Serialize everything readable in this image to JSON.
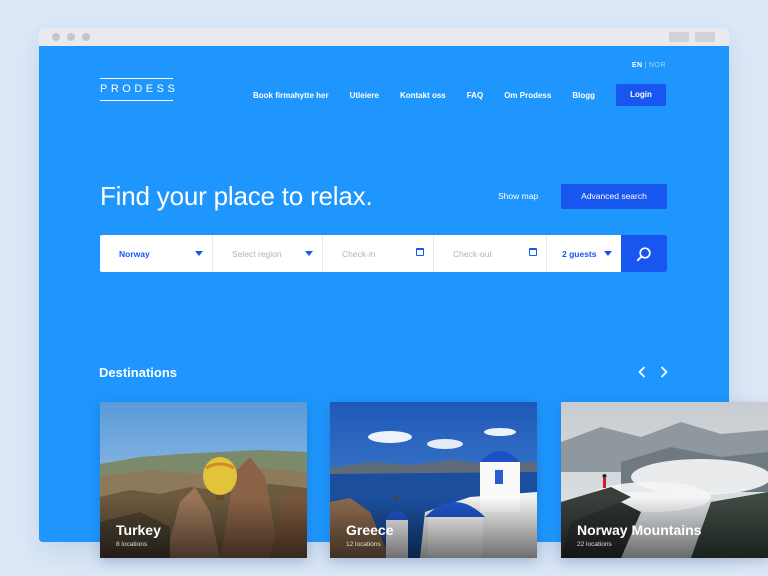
{
  "brand": {
    "logo": "PRODESS"
  },
  "lang": {
    "active": "EN",
    "inactive": "NOR"
  },
  "nav": {
    "links": [
      "Book firmahytte her",
      "Utleiere",
      "Kontakt oss",
      "FAQ",
      "Om Prodess",
      "Blogg"
    ],
    "login": "Login"
  },
  "hero": {
    "title": "Find your place to relax.",
    "show_map": "Show map",
    "advanced_search": "Advanced search"
  },
  "search": {
    "country": "Norway",
    "region_placeholder": "Select region",
    "checkin_placeholder": "Check-in",
    "checkout_placeholder": "Check-out",
    "guests": "2 guests"
  },
  "destinations": {
    "title": "Destinations",
    "cards": [
      {
        "name": "Turkey",
        "count": "8 locations"
      },
      {
        "name": "Greece",
        "count": "12 locations"
      },
      {
        "name": "Norway Mountains",
        "count": "22 locations"
      }
    ]
  },
  "colors": {
    "primary_bg": "#1e96fd",
    "accent": "#1856f0"
  }
}
